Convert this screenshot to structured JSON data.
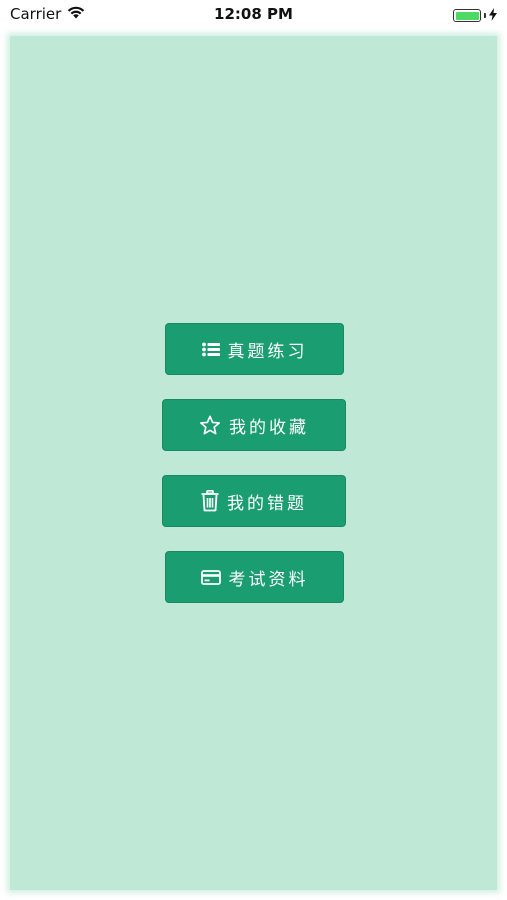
{
  "status_bar": {
    "carrier": "Carrier",
    "time": "12:08 PM"
  },
  "colors": {
    "background": "#bfe8d6",
    "button": "#1a9d71",
    "button_text": "#ffffff",
    "battery_fill": "#4cd964"
  },
  "menu": {
    "items": [
      {
        "label": "真题练习",
        "icon": "list-icon"
      },
      {
        "label": "我的收藏",
        "icon": "star-icon"
      },
      {
        "label": "我的错题",
        "icon": "trash-icon"
      },
      {
        "label": "考试资料",
        "icon": "credit-card-icon"
      }
    ]
  }
}
